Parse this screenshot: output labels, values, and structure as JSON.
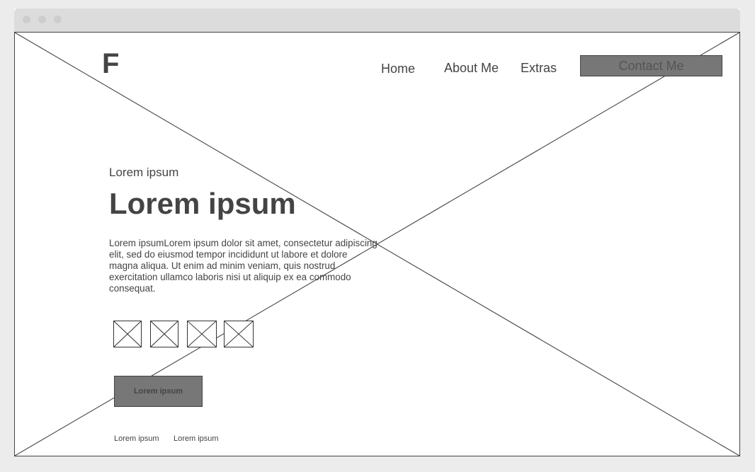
{
  "brand": {
    "logo_letter": "F"
  },
  "nav": {
    "items": [
      {
        "label": "Home"
      },
      {
        "label": "About Me"
      },
      {
        "label": "Extras"
      }
    ],
    "contact_label": "Contact Me"
  },
  "hero": {
    "eyebrow": "Lorem ipsum",
    "title": "Lorem ipsum",
    "body": "Lorem ipsumLorem ipsum dolor sit amet, consectetur adipiscing elit, sed do eiusmod tempor incididunt ut labore et dolore magna aliqua. Ut enim ad minim veniam, quis nostrud exercitation ullamco laboris nisi ut aliquip ex ea commodo consequat.",
    "cta_label": "Lorem ipsum"
  },
  "icons": [
    "image-placeholder-icon",
    "image-placeholder-icon",
    "image-placeholder-icon",
    "image-placeholder-icon"
  ],
  "footer": {
    "links": [
      {
        "label": "Lorem ipsum"
      },
      {
        "label": "Lorem ipsum"
      }
    ]
  },
  "colors": {
    "page_bg": "#ececec",
    "titlebar": "#dcdcdc",
    "button_fill": "#777777",
    "text": "#444444"
  }
}
